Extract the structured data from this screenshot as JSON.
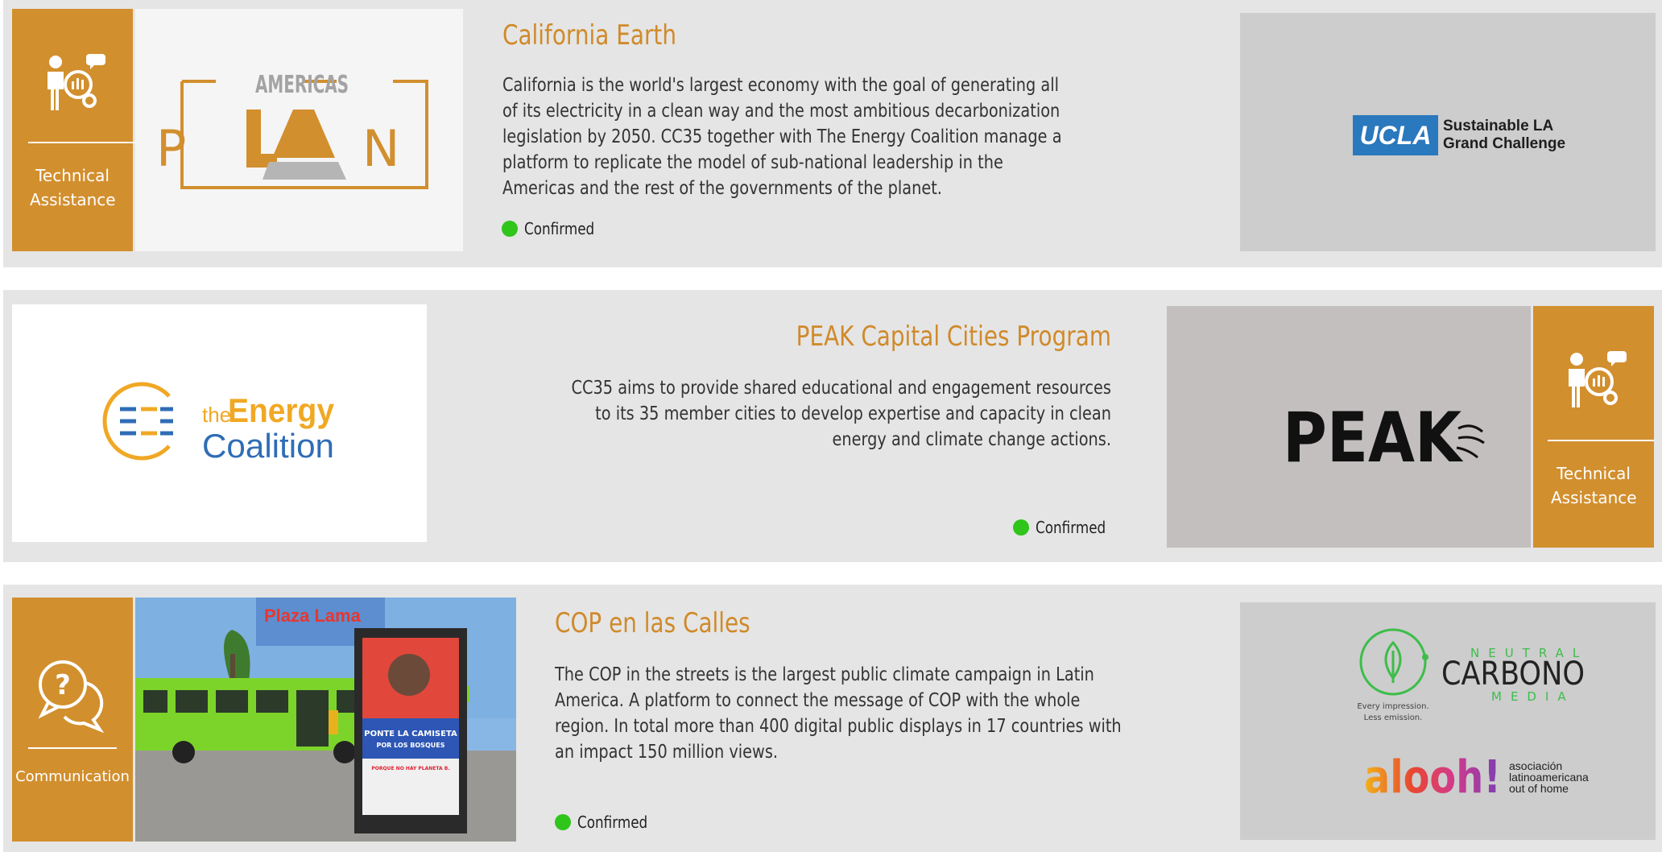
{
  "colors": {
    "accent": "#d28f2e",
    "title": "#d08a2a",
    "confirmed": "#2fc51a",
    "card_bg": "#e5e5e5"
  },
  "projects": [
    {
      "category": "Technical Assistance",
      "category_icon": "technical-assistance-icon",
      "title": "California Earth",
      "description": "California is the world's largest economy with the goal of generating all of its electricity in a clean way and the most ambitious decarbonization legislation by 2050. CC35 together with The Energy Coalition manage a platform to replicate the model of sub-national leadership in the Americas and the rest of the governments of the planet.",
      "status": "Confirmed",
      "image_logo": {
        "top": "AMERICAS",
        "word": "PLAN"
      },
      "partner_logo": {
        "badge": "UCLA",
        "line1": "Sustainable LA",
        "line2": "Grand Challenge"
      }
    },
    {
      "category": "Technical Assistance",
      "category_icon": "technical-assistance-icon",
      "title": "PEAK Capital Cities Program",
      "description": "CC35 aims to provide shared educational and engagement resources to its 35 member cities to develop expertise and capacity in clean energy and climate change actions.",
      "status": "Confirmed",
      "image_logo": {
        "the": "the",
        "energy": "Energy",
        "coalition": "Coalition"
      },
      "partner_logo": {
        "word": "PEAK"
      }
    },
    {
      "category": "Communication",
      "category_icon": "communication-icon",
      "title": "COP en las Calles",
      "description": "The COP in the streets is the largest public climate campaign in Latin America. A platform to connect the message of COP with the whole region. In total more than 400 digital public displays in 17 countries with an impact 150 million views.",
      "status": "Confirmed",
      "photo": {
        "sign": "Plaza Lama",
        "poster_line1": "PONTE LA CAMISETA",
        "poster_line2": "POR LOS BOSQUES",
        "poster_line3": "PORQUE NO HAY PLANETA B."
      },
      "partner_logos": {
        "neutral": "NEUTRAL",
        "carbono": "CARBONO",
        "media": "MEDIA",
        "tagline1": "Every impression.",
        "tagline2": "Less emission.",
        "alooh": "alooh!",
        "alooh_line1": "asociación",
        "alooh_line2": "latinoamericana",
        "alooh_line3": "out of home"
      }
    }
  ]
}
